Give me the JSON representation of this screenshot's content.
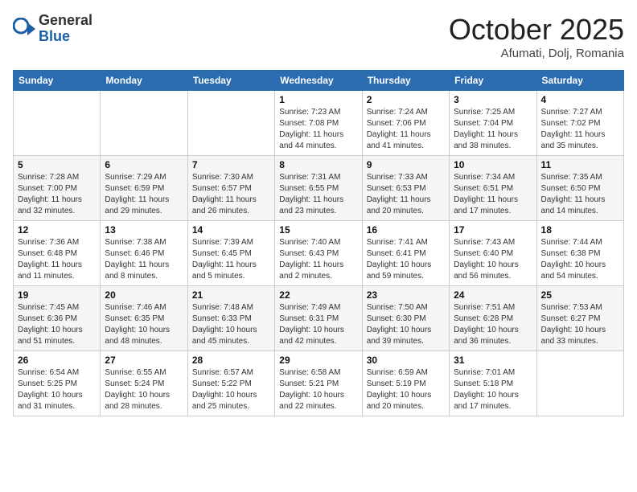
{
  "header": {
    "logo_general": "General",
    "logo_blue": "Blue",
    "month_title": "October 2025",
    "location": "Afumati, Dolj, Romania"
  },
  "days_of_week": [
    "Sunday",
    "Monday",
    "Tuesday",
    "Wednesday",
    "Thursday",
    "Friday",
    "Saturday"
  ],
  "weeks": [
    [
      {
        "day": "",
        "info": ""
      },
      {
        "day": "",
        "info": ""
      },
      {
        "day": "",
        "info": ""
      },
      {
        "day": "1",
        "info": "Sunrise: 7:23 AM\nSunset: 7:08 PM\nDaylight: 11 hours\nand 44 minutes."
      },
      {
        "day": "2",
        "info": "Sunrise: 7:24 AM\nSunset: 7:06 PM\nDaylight: 11 hours\nand 41 minutes."
      },
      {
        "day": "3",
        "info": "Sunrise: 7:25 AM\nSunset: 7:04 PM\nDaylight: 11 hours\nand 38 minutes."
      },
      {
        "day": "4",
        "info": "Sunrise: 7:27 AM\nSunset: 7:02 PM\nDaylight: 11 hours\nand 35 minutes."
      }
    ],
    [
      {
        "day": "5",
        "info": "Sunrise: 7:28 AM\nSunset: 7:00 PM\nDaylight: 11 hours\nand 32 minutes."
      },
      {
        "day": "6",
        "info": "Sunrise: 7:29 AM\nSunset: 6:59 PM\nDaylight: 11 hours\nand 29 minutes."
      },
      {
        "day": "7",
        "info": "Sunrise: 7:30 AM\nSunset: 6:57 PM\nDaylight: 11 hours\nand 26 minutes."
      },
      {
        "day": "8",
        "info": "Sunrise: 7:31 AM\nSunset: 6:55 PM\nDaylight: 11 hours\nand 23 minutes."
      },
      {
        "day": "9",
        "info": "Sunrise: 7:33 AM\nSunset: 6:53 PM\nDaylight: 11 hours\nand 20 minutes."
      },
      {
        "day": "10",
        "info": "Sunrise: 7:34 AM\nSunset: 6:51 PM\nDaylight: 11 hours\nand 17 minutes."
      },
      {
        "day": "11",
        "info": "Sunrise: 7:35 AM\nSunset: 6:50 PM\nDaylight: 11 hours\nand 14 minutes."
      }
    ],
    [
      {
        "day": "12",
        "info": "Sunrise: 7:36 AM\nSunset: 6:48 PM\nDaylight: 11 hours\nand 11 minutes."
      },
      {
        "day": "13",
        "info": "Sunrise: 7:38 AM\nSunset: 6:46 PM\nDaylight: 11 hours\nand 8 minutes."
      },
      {
        "day": "14",
        "info": "Sunrise: 7:39 AM\nSunset: 6:45 PM\nDaylight: 11 hours\nand 5 minutes."
      },
      {
        "day": "15",
        "info": "Sunrise: 7:40 AM\nSunset: 6:43 PM\nDaylight: 11 hours\nand 2 minutes."
      },
      {
        "day": "16",
        "info": "Sunrise: 7:41 AM\nSunset: 6:41 PM\nDaylight: 10 hours\nand 59 minutes."
      },
      {
        "day": "17",
        "info": "Sunrise: 7:43 AM\nSunset: 6:40 PM\nDaylight: 10 hours\nand 56 minutes."
      },
      {
        "day": "18",
        "info": "Sunrise: 7:44 AM\nSunset: 6:38 PM\nDaylight: 10 hours\nand 54 minutes."
      }
    ],
    [
      {
        "day": "19",
        "info": "Sunrise: 7:45 AM\nSunset: 6:36 PM\nDaylight: 10 hours\nand 51 minutes."
      },
      {
        "day": "20",
        "info": "Sunrise: 7:46 AM\nSunset: 6:35 PM\nDaylight: 10 hours\nand 48 minutes."
      },
      {
        "day": "21",
        "info": "Sunrise: 7:48 AM\nSunset: 6:33 PM\nDaylight: 10 hours\nand 45 minutes."
      },
      {
        "day": "22",
        "info": "Sunrise: 7:49 AM\nSunset: 6:31 PM\nDaylight: 10 hours\nand 42 minutes."
      },
      {
        "day": "23",
        "info": "Sunrise: 7:50 AM\nSunset: 6:30 PM\nDaylight: 10 hours\nand 39 minutes."
      },
      {
        "day": "24",
        "info": "Sunrise: 7:51 AM\nSunset: 6:28 PM\nDaylight: 10 hours\nand 36 minutes."
      },
      {
        "day": "25",
        "info": "Sunrise: 7:53 AM\nSunset: 6:27 PM\nDaylight: 10 hours\nand 33 minutes."
      }
    ],
    [
      {
        "day": "26",
        "info": "Sunrise: 6:54 AM\nSunset: 5:25 PM\nDaylight: 10 hours\nand 31 minutes."
      },
      {
        "day": "27",
        "info": "Sunrise: 6:55 AM\nSunset: 5:24 PM\nDaylight: 10 hours\nand 28 minutes."
      },
      {
        "day": "28",
        "info": "Sunrise: 6:57 AM\nSunset: 5:22 PM\nDaylight: 10 hours\nand 25 minutes."
      },
      {
        "day": "29",
        "info": "Sunrise: 6:58 AM\nSunset: 5:21 PM\nDaylight: 10 hours\nand 22 minutes."
      },
      {
        "day": "30",
        "info": "Sunrise: 6:59 AM\nSunset: 5:19 PM\nDaylight: 10 hours\nand 20 minutes."
      },
      {
        "day": "31",
        "info": "Sunrise: 7:01 AM\nSunset: 5:18 PM\nDaylight: 10 hours\nand 17 minutes."
      },
      {
        "day": "",
        "info": ""
      }
    ]
  ]
}
